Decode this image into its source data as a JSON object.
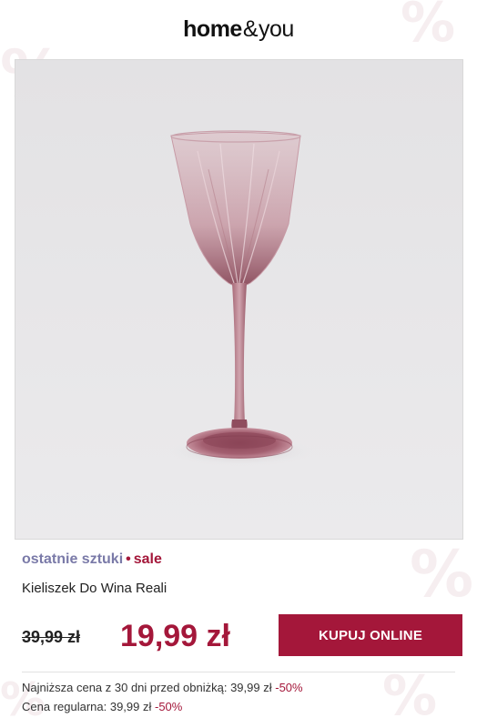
{
  "brand": {
    "logo_home": "home",
    "logo_amp": "&",
    "logo_you": "you"
  },
  "product": {
    "image_alt": "Kieliszek Do Wina Reali",
    "tag_last": "ostatnie sztuki",
    "tag_separator": "•",
    "tag_sale": "sale",
    "name": "Kieliszek Do Wina Reali",
    "old_price": "39,99 zł",
    "new_price": "19,99 zł",
    "buy_label": "KUPUJ ONLINE"
  },
  "price_info": {
    "lowest_label": "Najniższa cena z 30 dni przed obniżką: 39,99 zł",
    "lowest_discount": "-50%",
    "regular_label": "Cena regularna: 39,99 zł",
    "regular_discount": "-50%"
  },
  "colors": {
    "accent": "#a4173a",
    "tag_last": "#7a7aa8",
    "glass": "#b58590"
  }
}
